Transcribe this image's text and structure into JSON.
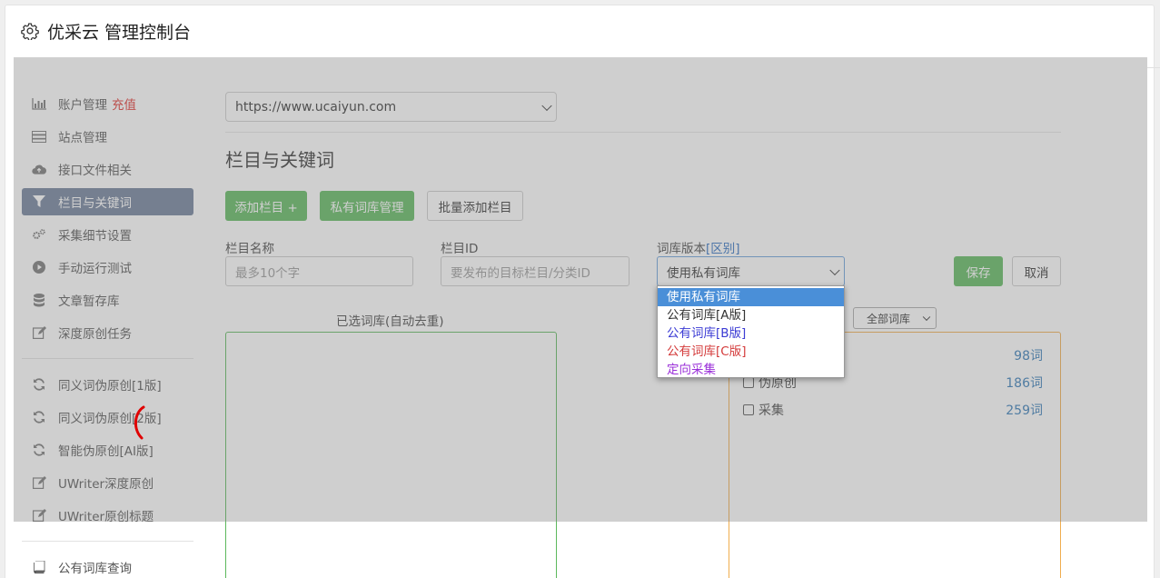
{
  "header": {
    "title": "优采云 管理控制台",
    "icon": "gear-icon"
  },
  "sidebar": {
    "items": [
      {
        "label": "账户管理",
        "badge": "充值",
        "icon": "bar-chart-icon"
      },
      {
        "label": "站点管理",
        "icon": "server-icon"
      },
      {
        "label": "接口文件相关",
        "icon": "cloud-upload-icon"
      },
      {
        "label": "栏目与关键词",
        "icon": "filter-icon",
        "active": true
      },
      {
        "label": "采集细节设置",
        "icon": "cogs-icon"
      },
      {
        "label": "手动运行测试",
        "icon": "play-circle-icon"
      },
      {
        "label": "文章暂存库",
        "icon": "database-icon"
      },
      {
        "label": "深度原创任务",
        "icon": "edit-icon"
      },
      {
        "label": "同义词伪原创[1版]",
        "icon": "refresh-icon"
      },
      {
        "label": "同义词伪原创[2版]",
        "icon": "refresh-icon"
      },
      {
        "label": "智能伪原创[AI版]",
        "icon": "refresh-icon"
      },
      {
        "label": "UWriter深度原创",
        "icon": "edit-icon"
      },
      {
        "label": "UWriter原创标题",
        "icon": "edit-icon"
      },
      {
        "label": "公有词库查询",
        "icon": "book-icon"
      }
    ]
  },
  "main": {
    "site_select": {
      "value": "https://www.ucaiyun.com"
    },
    "section_title": "栏目与关键词",
    "buttons": {
      "add_column": "添加栏目 +",
      "private_lib": "私有词库管理",
      "batch_add": "批量添加栏目",
      "save": "保存",
      "cancel": "取消"
    },
    "form": {
      "column_name_label": "栏目名称",
      "column_name_placeholder": "最多10个字",
      "column_id_label": "栏目ID",
      "column_id_placeholder": "要发布的目标栏目/分类ID",
      "lib_version_label": "词库版本",
      "lib_version_link": "[区别]",
      "lib_version_value": "使用私有词库"
    },
    "selected_lib_title": "已选词库(自动去重)",
    "lib_filter": "全部词库",
    "libraries": [
      {
        "name": "",
        "count": "98词"
      },
      {
        "name": "伪原创",
        "count": "186词"
      },
      {
        "name": "采集",
        "count": "259词"
      }
    ],
    "dropdown_options": [
      {
        "label": "使用私有词库",
        "color": "#ffffff",
        "selected": true
      },
      {
        "label": "公有词库[A版]",
        "color": "#333333"
      },
      {
        "label": "公有词库[B版]",
        "color": "#3b3bd4"
      },
      {
        "label": "公有词库[C版]",
        "color": "#d43b3b"
      },
      {
        "label": "定向采集",
        "color": "#9b30d9"
      }
    ]
  }
}
